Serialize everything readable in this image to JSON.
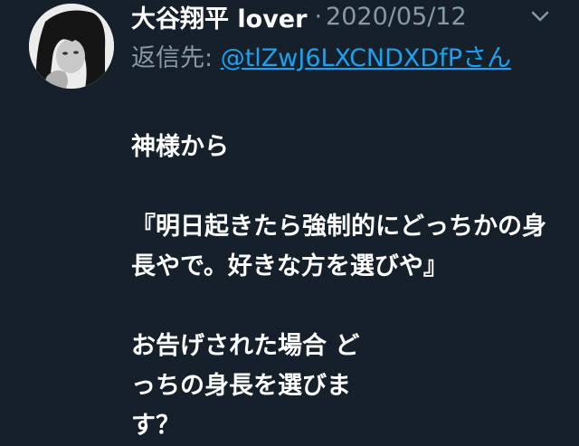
{
  "tweet": {
    "author": "大谷翔平 lover",
    "separator": "·",
    "date": "2020/05/12",
    "reply_prefix": "返信先: ",
    "reply_handle": "@tlZwJ6LXCNDXDfPさん",
    "paragraphs": [
      "神様から",
      "『明日起きたら強制的にどっちかの身長やで。好きな方を選びや』",
      "お告げされた場合 どっちの身長を選びます？"
    ]
  },
  "icons": {
    "caret": "chevron-down-icon",
    "avatar": "avatar-photo"
  },
  "colors": {
    "background": "#15202b",
    "text": "#ffffff",
    "secondary": "#8899a6",
    "link": "#1da1f2"
  }
}
